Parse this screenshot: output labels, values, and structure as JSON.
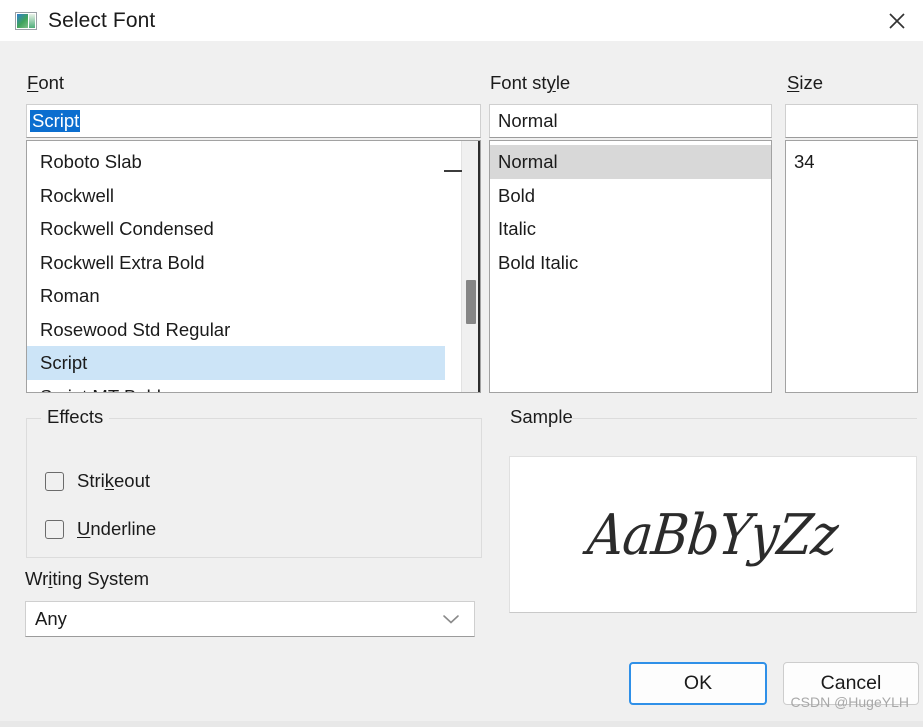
{
  "window": {
    "title": "Select Font",
    "icon": "font-preview-icon",
    "close_icon": "close-icon"
  },
  "font": {
    "label": "Font",
    "accelerator": "F",
    "label_rest": "ont",
    "input_value": "Script",
    "input_selected": true,
    "items": [
      "Roboto Slab",
      "Rockwell",
      "Rockwell Condensed",
      "Rockwell Extra Bold",
      "Roman",
      "Rosewood Std Regular",
      "Script",
      "Script MT Bold"
    ],
    "selected_item": "Script",
    "scrollbar": "vertical-scrollbar"
  },
  "font_style": {
    "label_head": "Font st",
    "accelerator": "y",
    "label_tail": "le",
    "input_value": "Normal",
    "items": [
      "Normal",
      "Bold",
      "Italic",
      "Bold Italic"
    ],
    "selected_item": "Normal"
  },
  "size": {
    "accelerator": "S",
    "label_rest": "ize",
    "input_value": "",
    "input_placeholder": "",
    "items": [
      "34"
    ],
    "selected_item": ""
  },
  "effects": {
    "title": "Effects",
    "items": [
      {
        "label_head": "Stri",
        "accelerator": "k",
        "label_tail": "eout",
        "checked": false
      },
      {
        "label_head": "",
        "accelerator": "U",
        "label_tail": "nderline",
        "checked": false
      }
    ]
  },
  "writing_system": {
    "label_head": "Wr",
    "accelerator": "i",
    "label_tail": "ting System",
    "value": "Any",
    "chevron_icon": "chevron-down-icon"
  },
  "sample": {
    "title": "Sample",
    "text": "AaBbYyZz"
  },
  "buttons": {
    "ok": "OK",
    "cancel": "Cancel"
  },
  "watermark": "CSDN @HugeYLH",
  "colors": {
    "dialog_bg": "#f0f0f0",
    "selection_blue": "#0b6ecf",
    "list_selection_blue": "#cce4f7",
    "list_selection_gray": "#d8d8d8",
    "focus_blue": "#2f90e8",
    "text": "#1b1b1b"
  }
}
